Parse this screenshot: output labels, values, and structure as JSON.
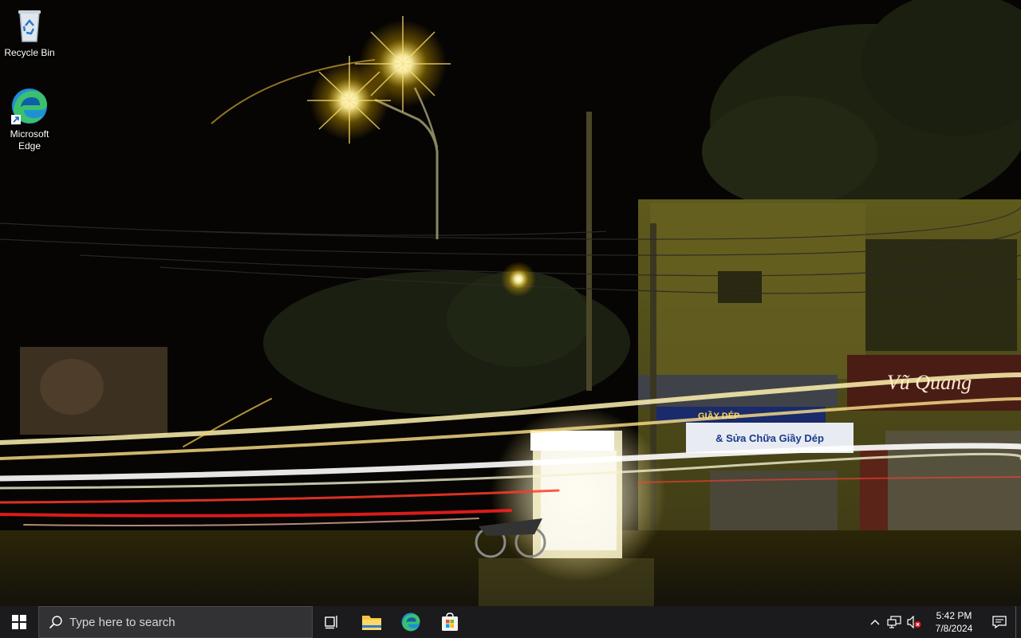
{
  "desktop": {
    "icons": [
      {
        "label": "Recycle Bin",
        "icon": "recycle-bin-icon"
      },
      {
        "label": "Microsoft Edge",
        "icon": "edge-icon"
      }
    ],
    "wallpaper": {
      "signs": {
        "shop_main": "Vũ Quang",
        "shop_sub": "& Sửa Chữa Giầy Dép",
        "shop_banner": "GIẦY DÉP"
      }
    }
  },
  "taskbar": {
    "start_icon": "windows-logo-icon",
    "search": {
      "placeholder": "Type here to search",
      "icon": "search-icon"
    },
    "apps": [
      {
        "name": "Task View",
        "icon": "task-view-icon"
      },
      {
        "name": "File Explorer",
        "icon": "folder-icon"
      },
      {
        "name": "Microsoft Edge",
        "icon": "edge-icon"
      },
      {
        "name": "Microsoft Store",
        "icon": "store-icon"
      }
    ],
    "tray": {
      "icons": [
        "chevron-up-icon",
        "network-icon",
        "volume-muted-icon",
        "notification-icon"
      ],
      "time": "5:42 PM",
      "date": "7/8/2024"
    }
  },
  "colors": {
    "taskbar_bg": "#1b1b1d",
    "search_bg": "#323235",
    "streetlight": "#ffd84a"
  }
}
